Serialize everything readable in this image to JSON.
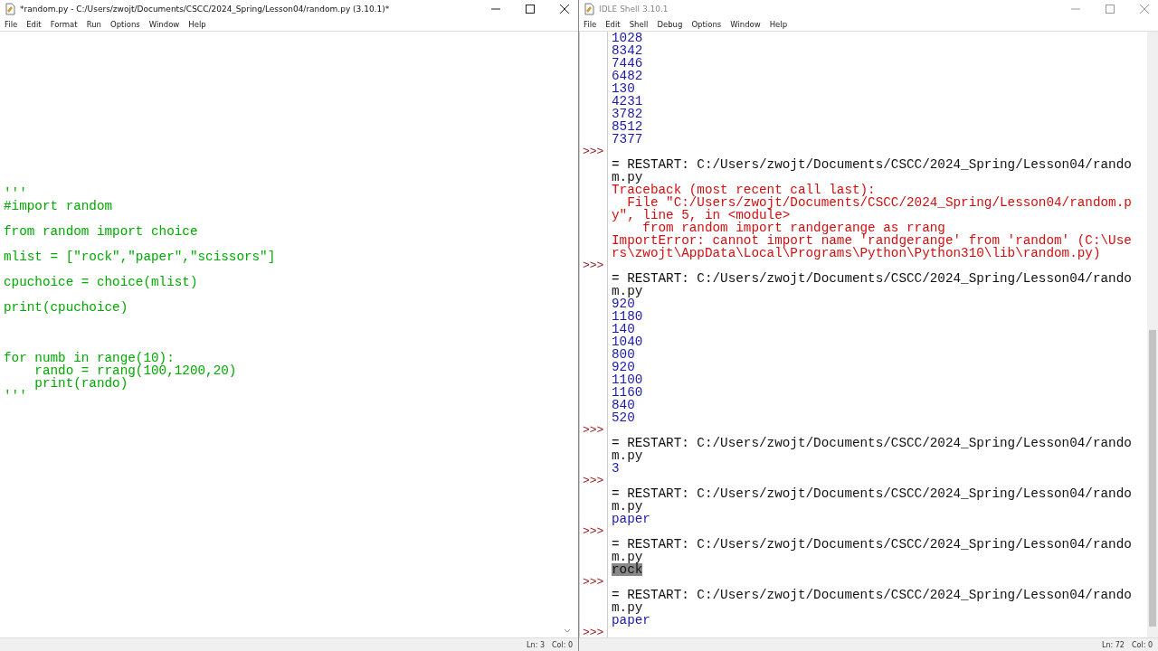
{
  "editor": {
    "title": "*random.py - C:/Users/zwojt/Documents/CSCC/2024_Spring/Lesson04/random.py (3.10.1)*",
    "menu": [
      "File",
      "Edit",
      "Format",
      "Run",
      "Options",
      "Window",
      "Help"
    ],
    "code": "'''\n#import random\n\nfrom random import choice\n\nmlist = [\"rock\",\"paper\",\"scissors\"]\n\ncpuchoice = choice(mlist)\n\nprint(cpuchoice)\n\n\n\nfor numb in range(10):\n    rando = rrang(100,1200,20)\n    print(rando)\n'''",
    "status": {
      "line": "Ln: 3",
      "col": "Col: 0"
    }
  },
  "shell": {
    "title": "IDLE Shell 3.10.1",
    "menu": [
      "File",
      "Edit",
      "Shell",
      "Debug",
      "Options",
      "Window",
      "Help"
    ],
    "lines": [
      {
        "kind": "output",
        "text": "1028"
      },
      {
        "kind": "output",
        "text": "8342"
      },
      {
        "kind": "output",
        "text": "7446"
      },
      {
        "kind": "output",
        "text": "6482"
      },
      {
        "kind": "output",
        "text": "130"
      },
      {
        "kind": "output",
        "text": "4231"
      },
      {
        "kind": "output",
        "text": "3782"
      },
      {
        "kind": "output",
        "text": "8512"
      },
      {
        "kind": "output",
        "text": "7377"
      },
      {
        "kind": "prompt",
        "text": ">>>"
      },
      {
        "kind": "restart",
        "text": "= RESTART: C:/Users/zwojt/Documents/CSCC/2024_Spring/Lesson04/rando"
      },
      {
        "kind": "restart",
        "text": "m.py"
      },
      {
        "kind": "error",
        "text": "Traceback (most recent call last):"
      },
      {
        "kind": "error",
        "text": "  File \"C:/Users/zwojt/Documents/CSCC/2024_Spring/Lesson04/random.p"
      },
      {
        "kind": "error",
        "text": "y\", line 5, in <module>"
      },
      {
        "kind": "error",
        "text": "    from random import randgerange as rrang"
      },
      {
        "kind": "error",
        "text": "ImportError: cannot import name 'randgerange' from 'random' (C:\\Use"
      },
      {
        "kind": "error",
        "text": "rs\\zwojt\\AppData\\Local\\Programs\\Python\\Python310\\lib\\random.py)"
      },
      {
        "kind": "prompt",
        "text": ">>>"
      },
      {
        "kind": "restart",
        "text": "= RESTART: C:/Users/zwojt/Documents/CSCC/2024_Spring/Lesson04/rando"
      },
      {
        "kind": "restart",
        "text": "m.py"
      },
      {
        "kind": "output",
        "text": "920"
      },
      {
        "kind": "output",
        "text": "1180"
      },
      {
        "kind": "output",
        "text": "140"
      },
      {
        "kind": "output",
        "text": "1040"
      },
      {
        "kind": "output",
        "text": "800"
      },
      {
        "kind": "output",
        "text": "920"
      },
      {
        "kind": "output",
        "text": "1100"
      },
      {
        "kind": "output",
        "text": "1160"
      },
      {
        "kind": "output",
        "text": "840"
      },
      {
        "kind": "output",
        "text": "520"
      },
      {
        "kind": "prompt",
        "text": ">>>"
      },
      {
        "kind": "restart",
        "text": "= RESTART: C:/Users/zwojt/Documents/CSCC/2024_Spring/Lesson04/rando"
      },
      {
        "kind": "restart",
        "text": "m.py"
      },
      {
        "kind": "output",
        "text": "3"
      },
      {
        "kind": "prompt",
        "text": ">>>"
      },
      {
        "kind": "restart",
        "text": "= RESTART: C:/Users/zwojt/Documents/CSCC/2024_Spring/Lesson04/rando"
      },
      {
        "kind": "restart",
        "text": "m.py"
      },
      {
        "kind": "output",
        "text": "paper"
      },
      {
        "kind": "prompt",
        "text": ">>>"
      },
      {
        "kind": "restart",
        "text": "= RESTART: C:/Users/zwojt/Documents/CSCC/2024_Spring/Lesson04/rando"
      },
      {
        "kind": "restart",
        "text": "m.py"
      },
      {
        "kind": "highlighted",
        "text": "rock"
      },
      {
        "kind": "prompt",
        "text": ">>>"
      },
      {
        "kind": "restart",
        "text": "= RESTART: C:/Users/zwojt/Documents/CSCC/2024_Spring/Lesson04/rando"
      },
      {
        "kind": "restart",
        "text": "m.py"
      },
      {
        "kind": "output",
        "text": "paper"
      },
      {
        "kind": "prompt",
        "text": ">>>"
      }
    ],
    "status": {
      "line": "Ln: 72",
      "col": "Col: 0"
    }
  }
}
